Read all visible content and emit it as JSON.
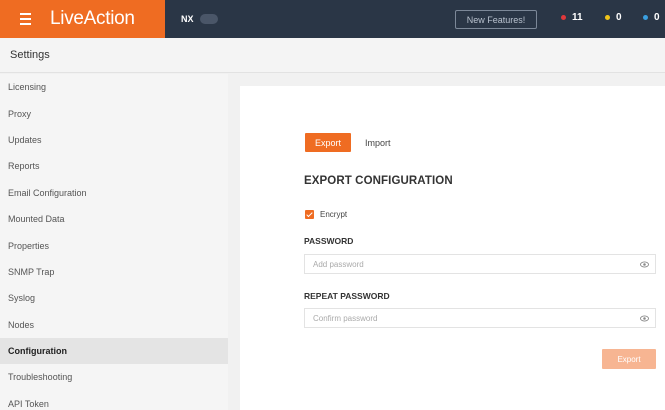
{
  "topbar": {
    "brand": "LiveAction",
    "tenant": "NX",
    "whats_new": "New Features!",
    "alerts": [
      {
        "color": "#e0383b",
        "count": "11"
      },
      {
        "color": "#f0c419",
        "count": "0"
      },
      {
        "color": "#3a9fe0",
        "count": "0"
      }
    ]
  },
  "header": {
    "title": "Settings"
  },
  "sidebar": {
    "items": [
      {
        "label": "Licensing"
      },
      {
        "label": "Proxy"
      },
      {
        "label": "Updates"
      },
      {
        "label": "Reports"
      },
      {
        "label": "Email Configuration"
      },
      {
        "label": "Mounted Data"
      },
      {
        "label": "Properties"
      },
      {
        "label": "SNMP Trap"
      },
      {
        "label": "Syslog"
      },
      {
        "label": "Nodes"
      },
      {
        "label": "Configuration"
      },
      {
        "label": "Troubleshooting"
      },
      {
        "label": "API Token"
      }
    ],
    "active": "Configuration"
  },
  "main": {
    "tabs": [
      {
        "label": "Export"
      },
      {
        "label": "Import"
      }
    ],
    "heading": "EXPORT CONFIGURATION",
    "encrypt_label": "Encrypt",
    "encrypt_checked": true,
    "password": {
      "label": "PASSWORD",
      "placeholder": "Add password"
    },
    "repeat_password": {
      "label": "REPEAT PASSWORD",
      "placeholder": "Confirm password"
    },
    "apply_label": "Export"
  },
  "colors": {
    "accent": "#ef6c22",
    "topbar": "#2a3646"
  }
}
